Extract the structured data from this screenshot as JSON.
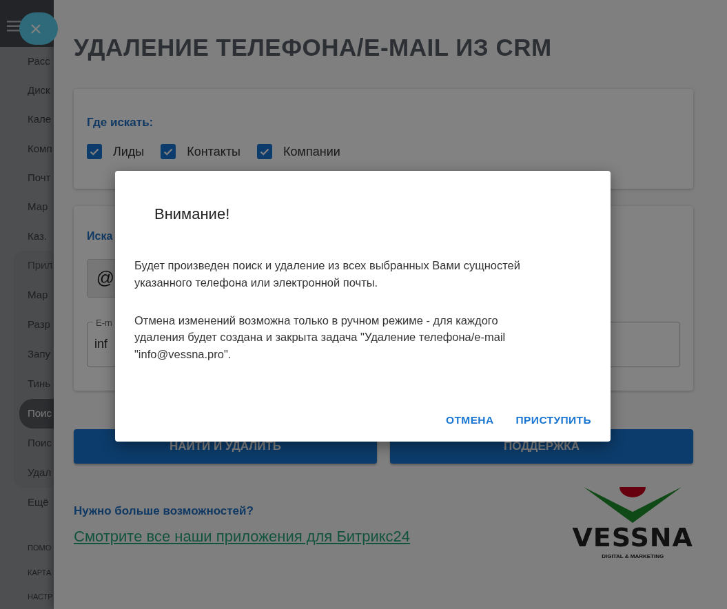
{
  "sidebar": {
    "items": [
      {
        "label": "Расс",
        "selected": false
      },
      {
        "label": "Диск",
        "selected": false
      },
      {
        "label": "Кале",
        "selected": false
      },
      {
        "label": "Комп",
        "selected": false
      },
      {
        "label": "Почт",
        "selected": false
      },
      {
        "label": "Мар",
        "selected": false
      },
      {
        "label": "Каз.",
        "selected": false
      }
    ],
    "group": {
      "label": "Прил",
      "items": [
        {
          "label": "Мар",
          "selected": false
        },
        {
          "label": "Разр",
          "selected": false
        },
        {
          "label": "Запу",
          "selected": false
        },
        {
          "label": "Тинь",
          "selected": false
        },
        {
          "label": "Поис",
          "selected": true
        },
        {
          "label": "Поис",
          "selected": false
        },
        {
          "label": "Удал",
          "selected": false
        }
      ]
    },
    "more": "Ещё",
    "footer_links": [
      "ПОМО",
      "КАРТА",
      "НАСТР"
    ]
  },
  "page": {
    "title": "УДАЛЕНИЕ ТЕЛЕФОНА/E-MAIL ИЗ CRM",
    "where_card": {
      "heading": "Где искать:",
      "options": [
        {
          "label": "Лиды",
          "checked": true
        },
        {
          "label": "Контакты",
          "checked": true
        },
        {
          "label": "Компании",
          "checked": true
        }
      ]
    },
    "search_card": {
      "heading": "Иска",
      "addon": "@",
      "field": {
        "label": "E-m",
        "value": "inf"
      }
    },
    "buttons": [
      "НАЙТИ И УДАЛИТЬ",
      "ПОДДЕРЖКА"
    ],
    "promo": {
      "heading": "Нужно больше возможностей?",
      "link": "Смотрите все наши приложения для Битрикс24"
    },
    "logo": {
      "name": "VESSNA",
      "tagline": "DIGITAL & MARKETING"
    }
  },
  "dialog": {
    "title": "Внимание!",
    "paragraphs": [
      {
        "lines": [
          "Будет произведен поиск и удаление из всех выбранных Вами сущностей",
          "указанного телефона или электронной почты."
        ]
      },
      {
        "lines": [
          "Отмена изменений возможна только в ручном режиме - для каждого",
          "удаления будет создана и закрыта задача \"Удаление телефона/e-mail",
          "\"info@vessna.pro\"."
        ]
      }
    ],
    "buttons": [
      "ОТМЕНА",
      "ПРИСТУПИТЬ"
    ]
  }
}
